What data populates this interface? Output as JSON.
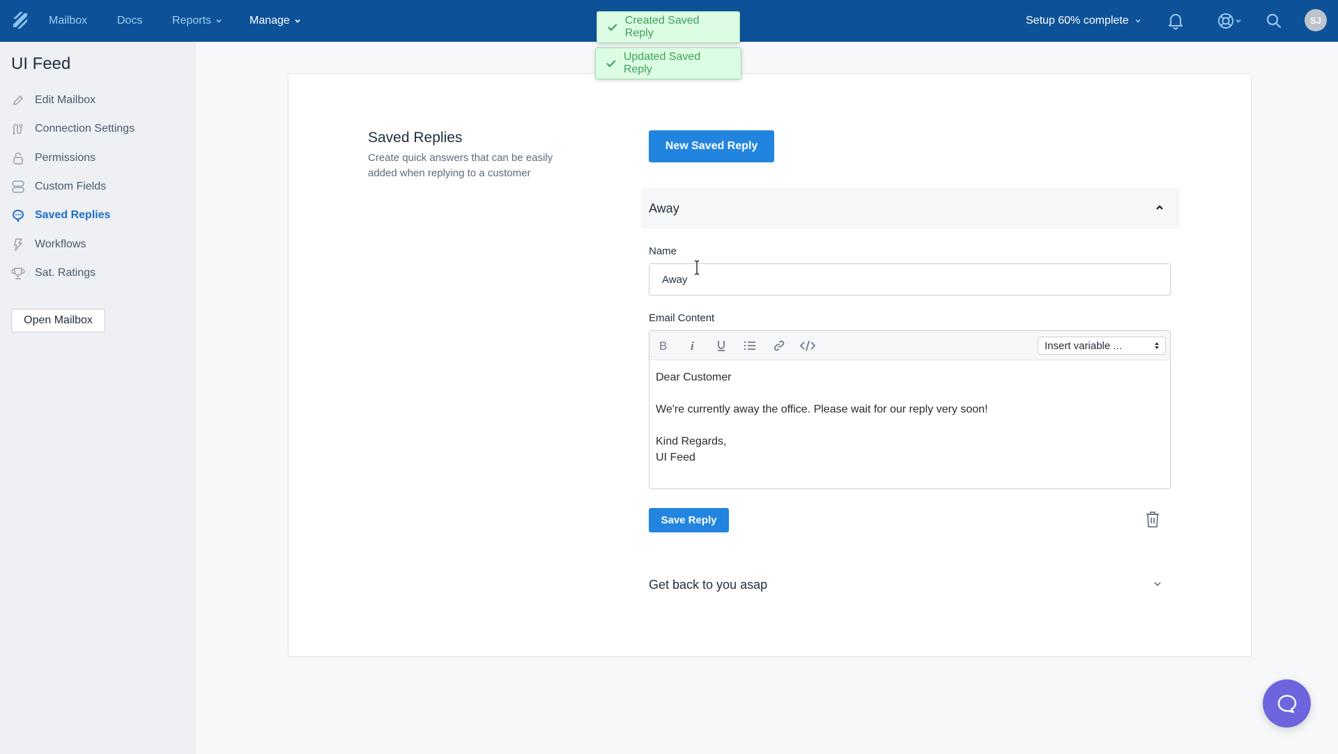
{
  "topbar": {
    "logo_icon": "helpscout-logo",
    "nav": [
      {
        "label": "Mailbox",
        "has_dropdown": false,
        "active": false
      },
      {
        "label": "Docs",
        "has_dropdown": false,
        "active": false
      },
      {
        "label": "Reports",
        "has_dropdown": true,
        "active": false
      },
      {
        "label": "Manage",
        "has_dropdown": true,
        "active": true
      }
    ],
    "setup_label": "Setup 60% complete",
    "setup_progress_percent": 60,
    "icons": [
      "bell-icon",
      "help-lifebuoy-icon",
      "search-icon"
    ],
    "avatar_initials": "SJ"
  },
  "toasts": [
    {
      "label": "Created Saved Reply",
      "status": "success"
    },
    {
      "label": "Updated Saved Reply",
      "status": "success"
    }
  ],
  "sidebar": {
    "title": "UI Feed",
    "items": [
      {
        "label": "Edit Mailbox",
        "icon": "pencil-icon",
        "active": false
      },
      {
        "label": "Connection Settings",
        "icon": "connection-icon",
        "active": false
      },
      {
        "label": "Permissions",
        "icon": "lock-icon",
        "active": false
      },
      {
        "label": "Custom Fields",
        "icon": "fields-icon",
        "active": false
      },
      {
        "label": "Saved Replies",
        "icon": "chat-bubble-icon",
        "active": true
      },
      {
        "label": "Workflows",
        "icon": "lightning-icon",
        "active": false
      },
      {
        "label": "Sat. Ratings",
        "icon": "trophy-icon",
        "active": false
      }
    ],
    "open_mailbox_label": "Open Mailbox"
  },
  "main": {
    "title": "Saved Replies",
    "description": "Create quick answers that can be easily added when replying to a customer",
    "new_button_label": "New Saved Reply",
    "replies": [
      {
        "title": "Away",
        "expanded": true,
        "name_label": "Name",
        "name_value": "Away",
        "content_label": "Email Content",
        "toolbar": [
          "bold",
          "italic",
          "underline",
          "bulleted-list",
          "link",
          "code"
        ],
        "insert_variable_label": "Insert variable ...",
        "content_lines": [
          "Dear Customer",
          "",
          "We're currently away the office. Please wait for our reply very soon!",
          "",
          "Kind Regards,",
          "UI Feed"
        ],
        "save_label": "Save Reply"
      },
      {
        "title": "Get back to you asap",
        "expanded": false
      }
    ]
  },
  "colors": {
    "topbar": "#0d5298",
    "accent": "#2185e0",
    "active_sidebar": "#1d6fc4",
    "toast_bg": "#dcfde3",
    "toast_text": "#3f9f5a",
    "chat_fab": "#6c65dd"
  }
}
